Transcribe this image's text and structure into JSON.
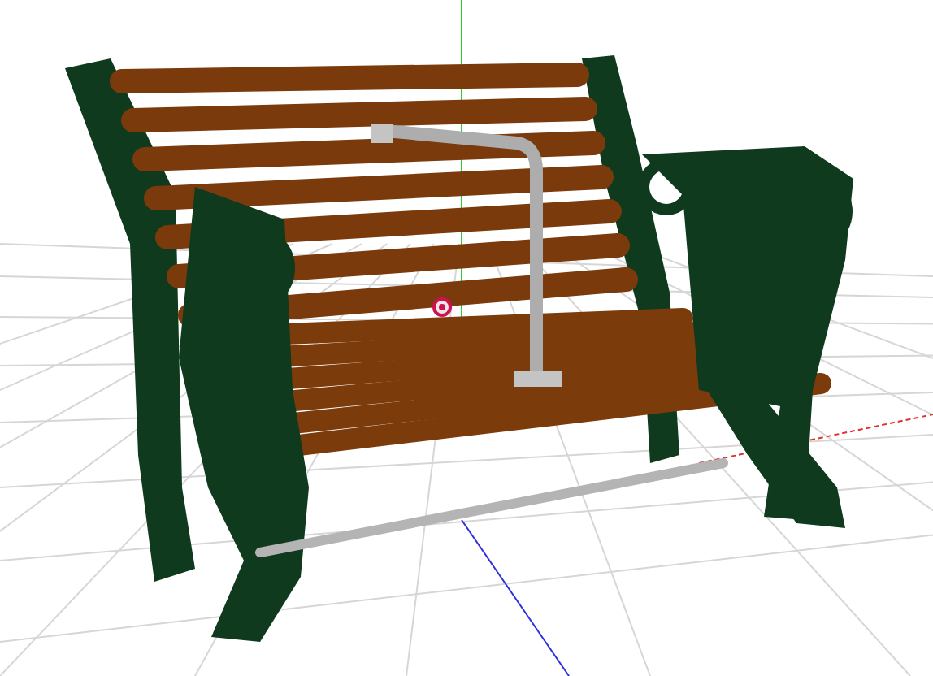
{
  "viewport": {
    "kind": "bench"
  }
}
